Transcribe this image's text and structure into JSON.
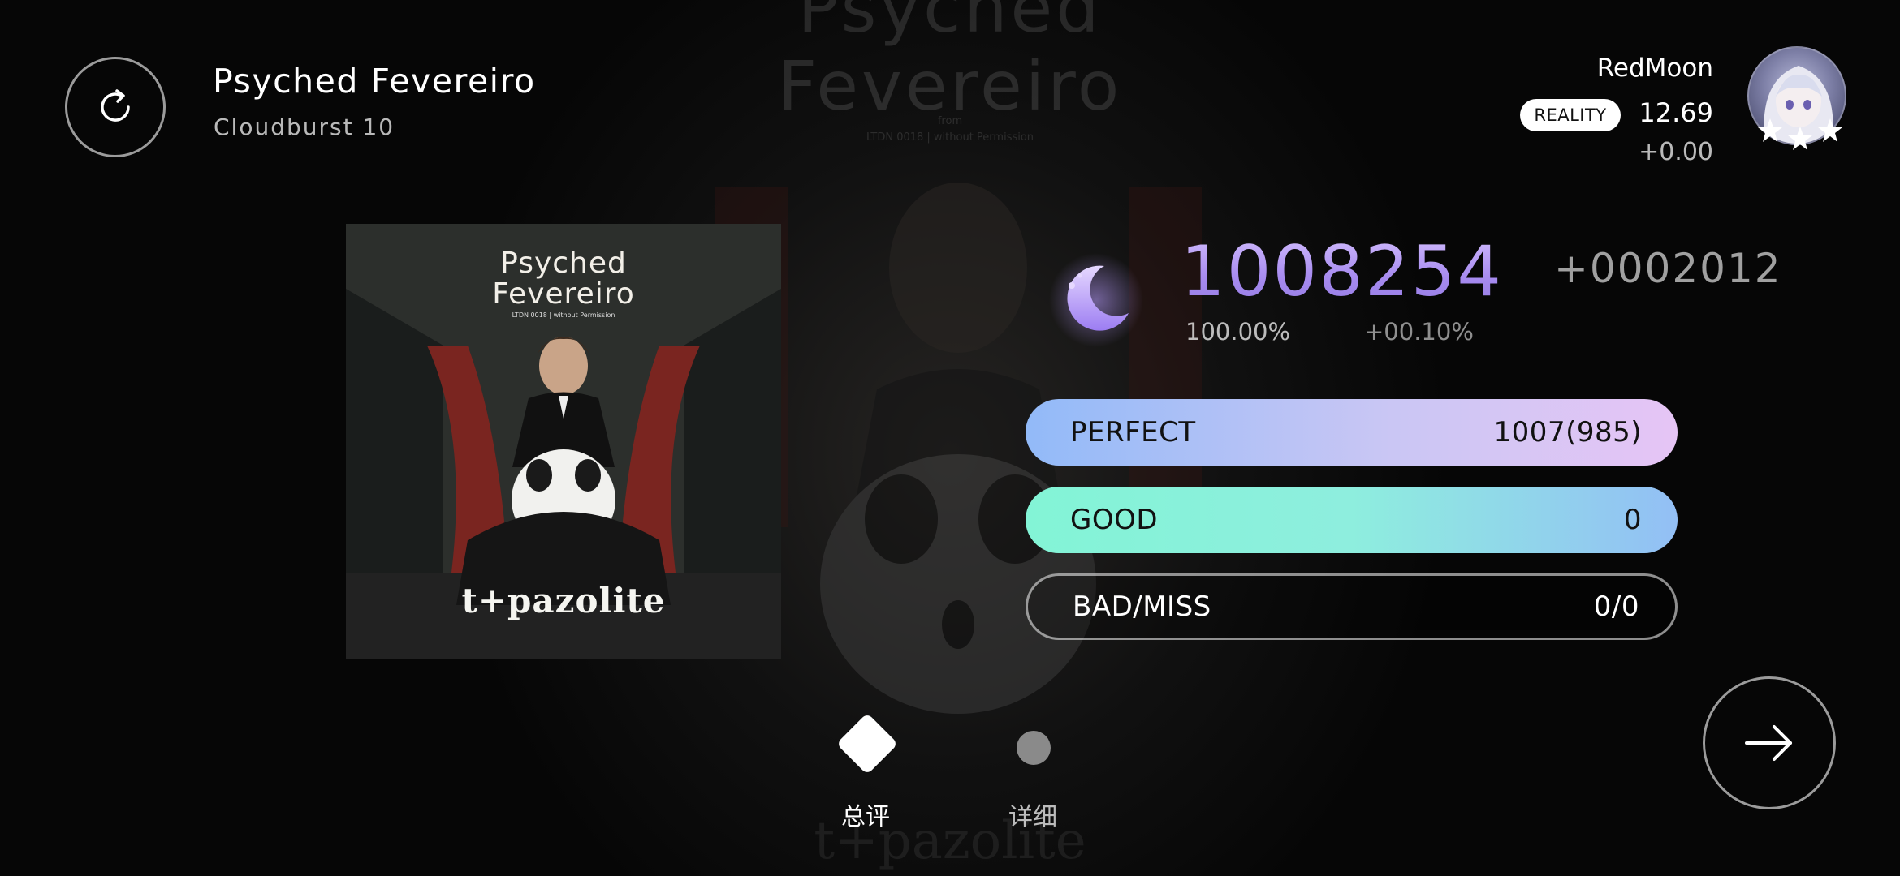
{
  "background": {
    "title_line1": "Psyched",
    "title_line2": "Fevereiro",
    "credit_line1": "from",
    "credit_line2": "LTDN 0018 | without Permission",
    "brand": "t+pazolite"
  },
  "song": {
    "title": "Psyched Fevereiro",
    "difficulty": "Cloudburst 10"
  },
  "player": {
    "name": "RedMoon",
    "tier": "REALITY",
    "rating": "12.69",
    "rating_delta": "+0.00",
    "avatar_stars": 3
  },
  "cover": {
    "title_line1": "Psyched",
    "title_line2": "Fevereiro",
    "credit": "LTDN 0018 | without Permission",
    "brand": "t+pazolite"
  },
  "result": {
    "grade_icon": "crescent-moon-icon",
    "score": "1008254",
    "score_delta": "+0002012",
    "accuracy": "100.00%",
    "accuracy_delta": "+00.10%"
  },
  "judgements": {
    "perfect": {
      "label": "PERFECT",
      "value": "1007(985)"
    },
    "good": {
      "label": "GOOD",
      "value": "0"
    },
    "bad_miss": {
      "label": "BAD/MISS",
      "value": "0/0"
    }
  },
  "tabs": {
    "summary": "总评",
    "detail": "详细",
    "active": "summary"
  },
  "colors": {
    "score_gradient_top": "#d8c4ff",
    "score_gradient_bottom": "#9078e0",
    "perfect_bar": "#c9c6f4",
    "good_bar": "#8eeede"
  }
}
